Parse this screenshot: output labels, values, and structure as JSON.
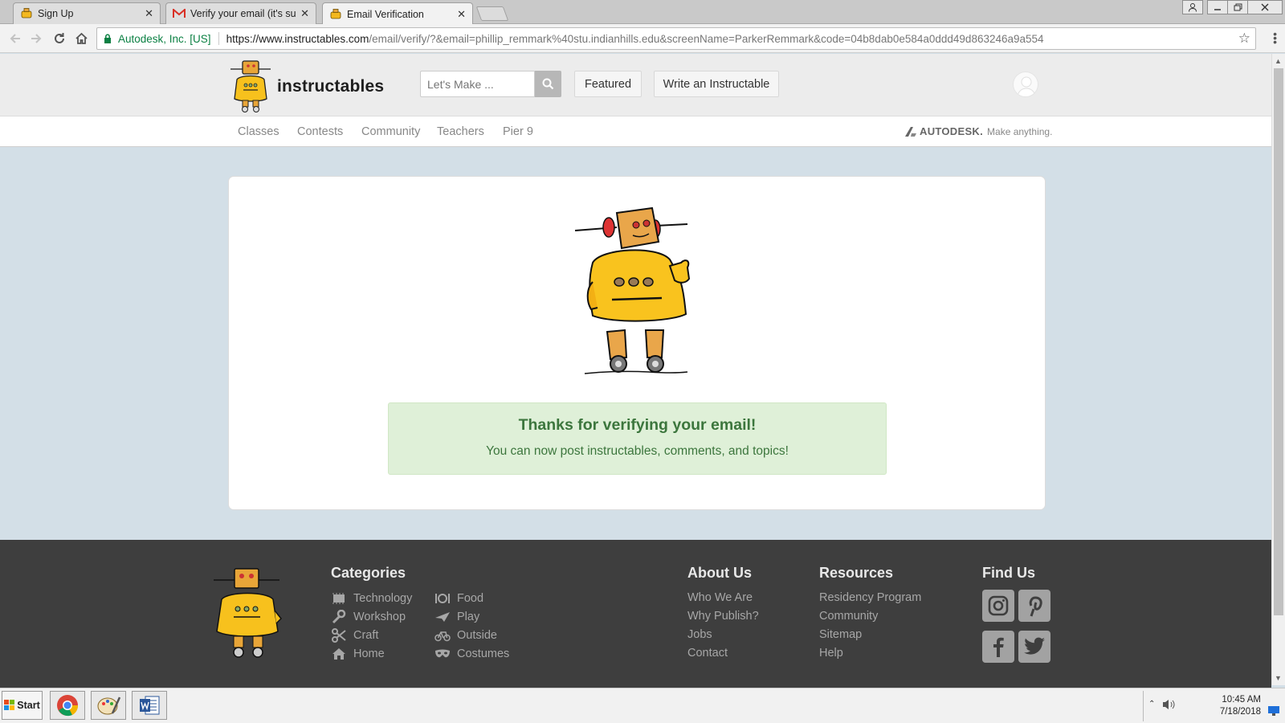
{
  "browser": {
    "tabs": [
      {
        "title": "Sign Up",
        "icon": "robot-favicon-icon",
        "active": false
      },
      {
        "title": "Verify your email (it's sup",
        "icon": "gmail-icon",
        "active": false
      },
      {
        "title": "Email Verification",
        "icon": "robot-favicon-icon",
        "active": true
      }
    ],
    "close_glyph": "✕",
    "cert_label": "Autodesk, Inc. [US]",
    "url_host": "https://www.instructables.com",
    "url_path": "/email/verify/?&email=phillip_remmark%40stu.indianhills.edu&screenName=ParkerRemmark&code=04b8dab0e584a0ddd49d863246a9a554"
  },
  "site": {
    "logo_text": "instructables",
    "search_placeholder": "Let's Make ...",
    "featured_label": "Featured",
    "write_label": "Write an Instructable",
    "subnav": [
      "Classes",
      "Contests",
      "Community",
      "Teachers",
      "Pier 9"
    ],
    "autodesk_brand": "AUTODESK.",
    "autodesk_tagline": "Make anything."
  },
  "alert": {
    "heading": "Thanks for verifying your email!",
    "message": "You can now post instructables, comments, and topics!",
    "bg_color": "#dff0d8",
    "text_color": "#3c763d"
  },
  "footer": {
    "categories_heading": "Categories",
    "categories_col1": [
      {
        "label": "Technology",
        "icon": "chip-icon"
      },
      {
        "label": "Workshop",
        "icon": "wrench-icon"
      },
      {
        "label": "Craft",
        "icon": "scissors-icon"
      },
      {
        "label": "Home",
        "icon": "house-icon"
      }
    ],
    "categories_col2": [
      {
        "label": "Food",
        "icon": "plate-icon"
      },
      {
        "label": "Play",
        "icon": "paper-plane-icon"
      },
      {
        "label": "Outside",
        "icon": "bicycle-icon"
      },
      {
        "label": "Costumes",
        "icon": "mask-icon"
      }
    ],
    "about_heading": "About Us",
    "about_links": [
      "Who We Are",
      "Why Publish?",
      "Jobs",
      "Contact"
    ],
    "resources_heading": "Resources",
    "resources_links": [
      "Residency Program",
      "Community",
      "Sitemap",
      "Help"
    ],
    "find_heading": "Find Us",
    "social": [
      "instagram-icon",
      "pinterest-icon",
      "facebook-icon",
      "twitter-icon"
    ]
  },
  "taskbar": {
    "start_label": "Start",
    "time": "10:45 AM",
    "date": "7/18/2018"
  }
}
